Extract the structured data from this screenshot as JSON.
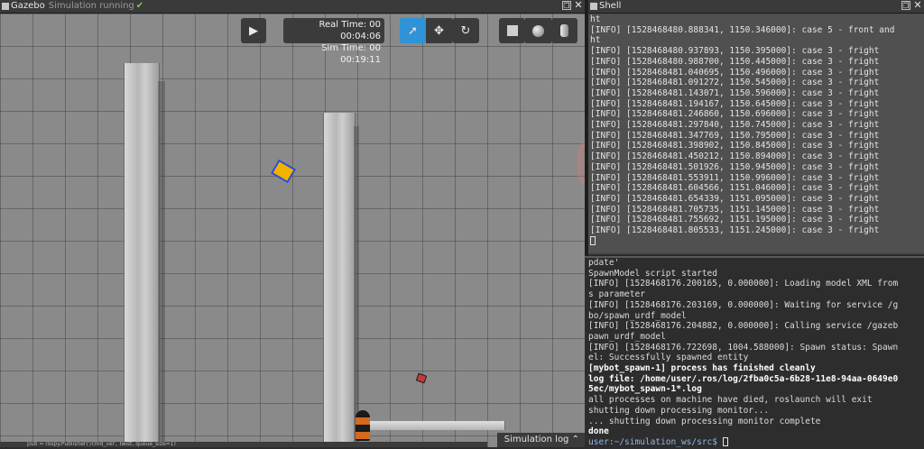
{
  "gazebo": {
    "title": "Gazebo",
    "status": "Simulation running",
    "real_time_label": "Real Time: 00",
    "real_time_value": "00:04:06",
    "sim_time_label": "Sim Time: 00",
    "sim_time_value": "00:19:11",
    "simulation_log_label": "Simulation log",
    "bottom_strip_text": "pub = rospy.Publisher('/cmd_vel', Twist, queue_size=1)",
    "toolbar": {
      "play_icon": "play-icon",
      "select_icon": "arrow-pointer-icon",
      "translate_icon": "move-arrows-icon",
      "rotate_icon": "rotate-icon",
      "box_icon": "box-icon",
      "sphere_icon": "sphere-icon",
      "cylinder_icon": "cylinder-icon"
    },
    "colors": {
      "active_tool": "#2f93d6",
      "robot": "#f2b200",
      "robot_trim": "#2a4fd8"
    }
  },
  "shell": {
    "title": "Shell",
    "lines": [
      "ht",
      "[INFO] [1528468480.888341, 1150.346000]: case 5 - front and",
      "ht",
      "[INFO] [1528468480.937893, 1150.395000]: case 3 - fright",
      "[INFO] [1528468480.988700, 1150.445000]: case 3 - fright",
      "[INFO] [1528468481.040695, 1150.496000]: case 3 - fright",
      "[INFO] [1528468481.091272, 1150.545000]: case 3 - fright",
      "[INFO] [1528468481.143071, 1150.596000]: case 3 - fright",
      "[INFO] [1528468481.194167, 1150.645000]: case 3 - fright",
      "[INFO] [1528468481.246860, 1150.696000]: case 3 - fright",
      "[INFO] [1528468481.297840, 1150.745000]: case 3 - fright",
      "[INFO] [1528468481.347769, 1150.795000]: case 3 - fright",
      "[INFO] [1528468481.398902, 1150.845000]: case 3 - fright",
      "[INFO] [1528468481.450212, 1150.894000]: case 3 - fright",
      "[INFO] [1528468481.501926, 1150.945000]: case 3 - fright",
      "[INFO] [1528468481.553911, 1150.996000]: case 3 - fright",
      "[INFO] [1528468481.604566, 1151.046000]: case 3 - fright",
      "[INFO] [1528468481.654339, 1151.095000]: case 3 - fright",
      "[INFO] [1528468481.705735, 1151.145000]: case 3 - fright",
      "[INFO] [1528468481.755692, 1151.195000]: case 3 - fright",
      "[INFO] [1528468481.805533, 1151.245000]: case 3 - fright"
    ]
  },
  "terminal": {
    "lines": [
      "pdate'",
      "SpawnModel script started",
      "[INFO] [1528468176.200165, 0.000000]: Loading model XML from",
      "s parameter",
      "[INFO] [1528468176.203169, 0.000000]: Waiting for service /g",
      "bo/spawn_urdf_model",
      "[INFO] [1528468176.204882, 0.000000]: Calling service /gazeb",
      "pawn_urdf_model",
      "[INFO] [1528468176.722698, 1004.588000]: Spawn status: Spawn",
      "el: Successfully spawned entity"
    ],
    "bold_lines": [
      "[mybot_spawn-1] process has finished cleanly",
      "log file: /home/user/.ros/log/2fba0c5a-6b28-11e8-94aa-0649e0",
      "5ec/mybot_spawn-1*.log"
    ],
    "tail_lines": [
      "all processes on machine have died, roslaunch will exit",
      "shutting down processing monitor...",
      "... shutting down processing monitor complete"
    ],
    "done": "done",
    "prompt": "user:~/simulation_ws/src$"
  }
}
